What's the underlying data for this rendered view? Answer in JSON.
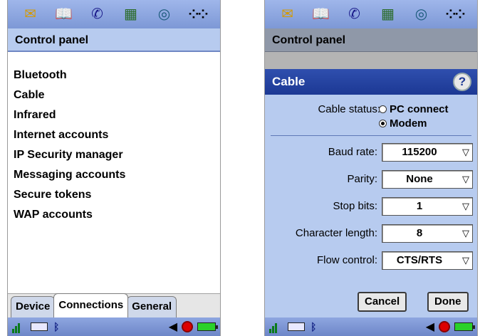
{
  "left": {
    "title": "Control panel",
    "items": [
      "Bluetooth",
      "Cable",
      "Infrared",
      "Internet accounts",
      "IP Security manager",
      "Messaging accounts",
      "Secure tokens",
      "WAP accounts"
    ],
    "tabs": [
      "Device",
      "Connections",
      "General"
    ],
    "active_tab": "Connections"
  },
  "right": {
    "title": "Control panel",
    "dialog": {
      "title": "Cable",
      "help": "?",
      "cable_status_label": "Cable status:",
      "options": [
        "PC connect",
        "Modem"
      ],
      "selected_option": "Modem",
      "fields": [
        {
          "label": "Baud rate:",
          "value": "115200"
        },
        {
          "label": "Parity:",
          "value": "None"
        },
        {
          "label": "Stop bits:",
          "value": "1"
        },
        {
          "label": "Character length:",
          "value": "8"
        },
        {
          "label": "Flow control:",
          "value": "CTS/RTS"
        }
      ],
      "cancel_label": "Cancel",
      "done_label": "Done"
    }
  },
  "app_icons": [
    "mail-icon",
    "contacts-icon",
    "phone-icon",
    "calendar-icon",
    "web-icon",
    "apps-icon"
  ],
  "status_icons": [
    "signal-icon",
    "keyboard-icon",
    "bluetooth-icon",
    "speaker-icon",
    "clock-icon",
    "battery-icon"
  ],
  "colors": {
    "accent": "#1c3894",
    "title_bg": "#b7cbef",
    "bar": "#7d98d6"
  }
}
